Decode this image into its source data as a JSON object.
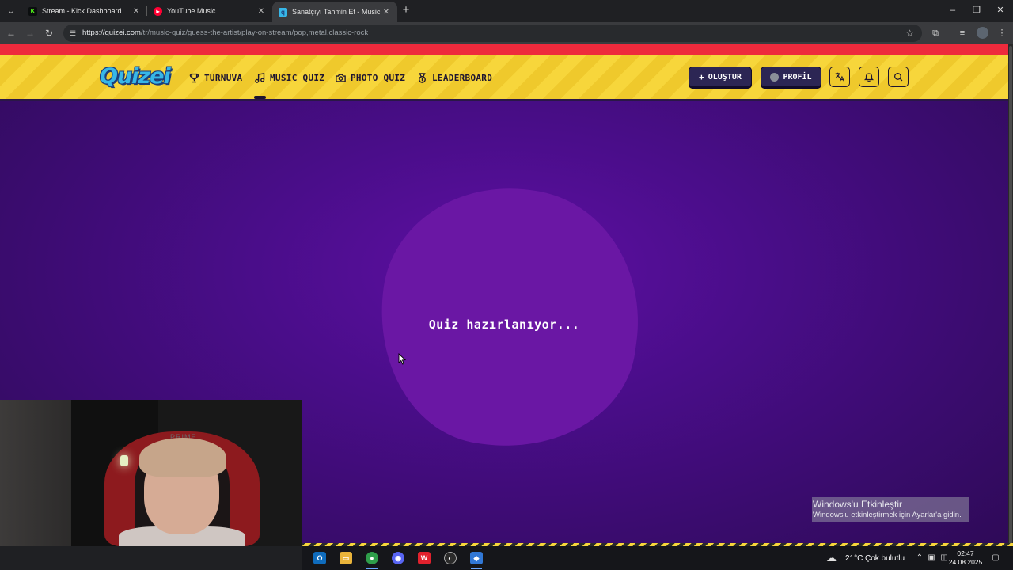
{
  "browser": {
    "tabs": [
      {
        "title": "Stream - Kick Dashboard",
        "favicon": "kick-icon",
        "color": "#53fc18"
      },
      {
        "title": "YouTube Music",
        "favicon": "youtube-music-icon",
        "color": "#ff0033"
      },
      {
        "title": "Sanatçıyı Tahmin Et - Music Qu",
        "favicon": "quizei-favicon",
        "color": "#37b7e8",
        "active": true
      }
    ],
    "url_host": "https://quizei.com",
    "url_path": "/tr/music-quiz/guess-the-artist/play-on-stream/pop,metal,classic-rock"
  },
  "site": {
    "logo": "Quizei",
    "nav": [
      {
        "label": "TURNUVA",
        "icon": "trophy-icon"
      },
      {
        "label": "MUSIC QUIZ",
        "icon": "music-note-icon",
        "active": true
      },
      {
        "label": "PHOTO QUIZ",
        "icon": "camera-icon"
      },
      {
        "label": "LEADERBOARD",
        "icon": "medal-icon"
      }
    ],
    "create_button": "OLUŞTUR",
    "profile_button": "PROFİL",
    "accent_red": "#ee2a3c",
    "header_yellow": "#f7d63b",
    "background_purple": "#4a0d8a"
  },
  "main": {
    "loading_text": "Quiz hazırlanıyor..."
  },
  "webcam": {
    "brand_text": "PRIME"
  },
  "os": {
    "activation_title": "Windows'u Etkinleştir",
    "activation_sub": "Windows'u etkinleştirmek için Ayarlar'a gidin.",
    "weather": "21°C",
    "weather_desc": "Çok bulutlu",
    "time": "02:47",
    "date": "24.08.2025"
  }
}
